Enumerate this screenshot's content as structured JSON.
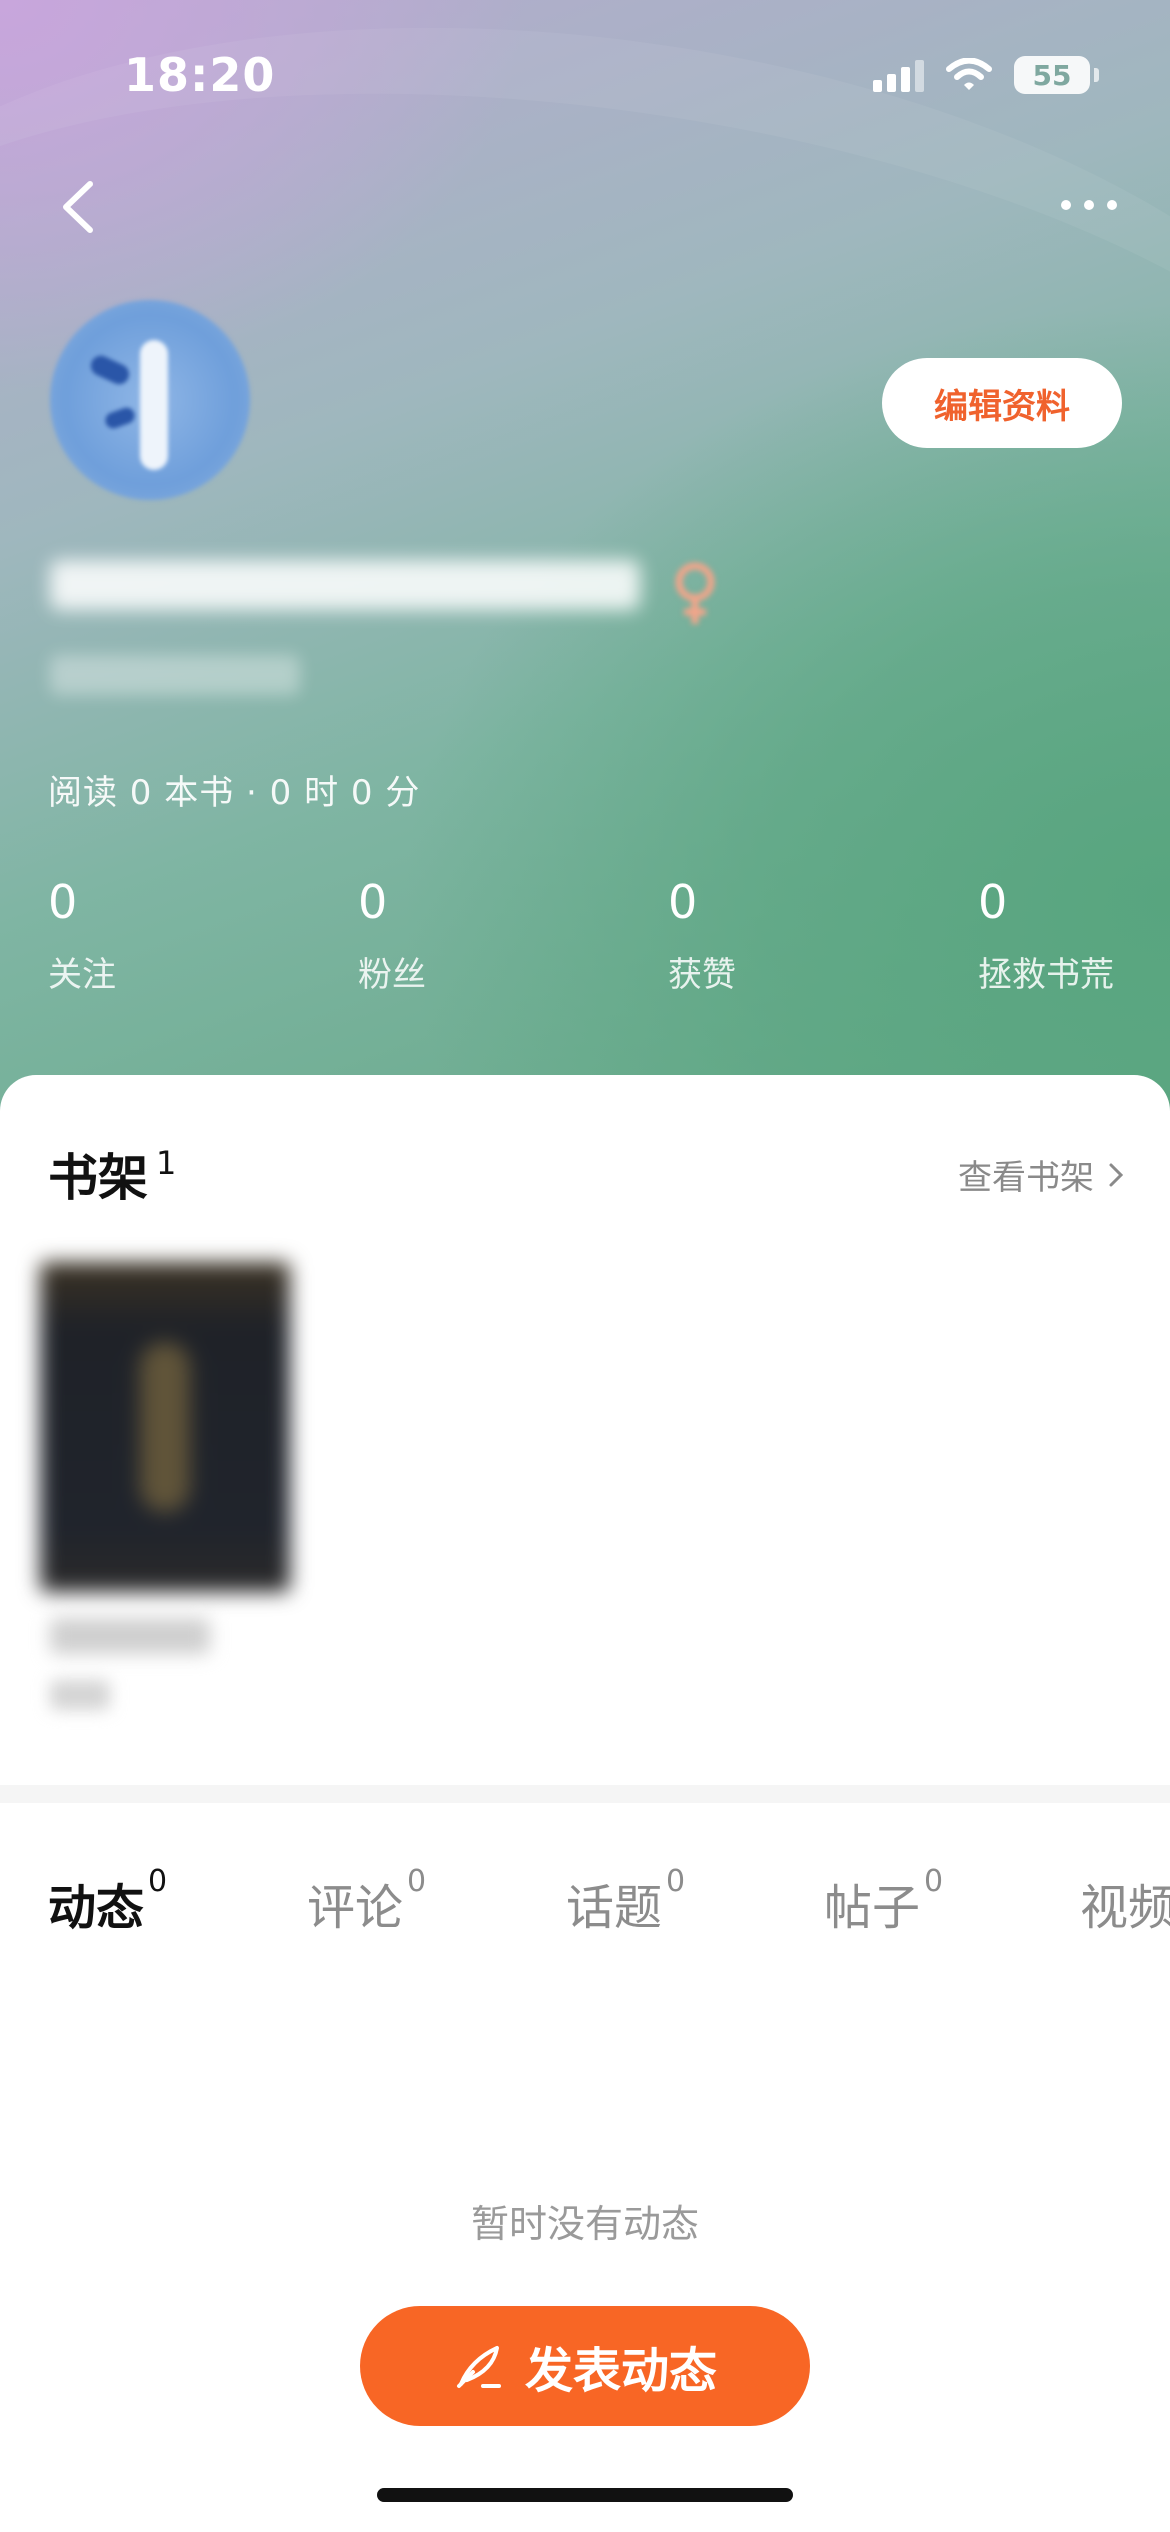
{
  "status_bar": {
    "time": "18:20",
    "battery": "55"
  },
  "profile": {
    "edit_label": "编辑资料",
    "read_stats": "阅读 0 本书 · 0 时 0 分",
    "stats": [
      {
        "value": "0",
        "label": "关注"
      },
      {
        "value": "0",
        "label": "粉丝"
      },
      {
        "value": "0",
        "label": "获赞"
      },
      {
        "value": "0",
        "label": "拯救书荒"
      }
    ]
  },
  "bookshelf": {
    "title": "书架",
    "count": "1",
    "view_all": "查看书架"
  },
  "tabs": [
    {
      "label": "动态",
      "count": "0"
    },
    {
      "label": "评论",
      "count": "0"
    },
    {
      "label": "话题",
      "count": "0"
    },
    {
      "label": "帖子",
      "count": "0"
    },
    {
      "label": "视频",
      "count": ""
    }
  ],
  "empty_text": "暂时没有动态",
  "post_button": "发表动态",
  "colors": {
    "accent": "#f86625",
    "edit_text": "#f0622d"
  },
  "icons": [
    "back-icon",
    "more-icon",
    "chevron-right-icon",
    "pen-icon",
    "female-icon",
    "wifi-icon",
    "signal-icon",
    "battery-icon"
  ]
}
